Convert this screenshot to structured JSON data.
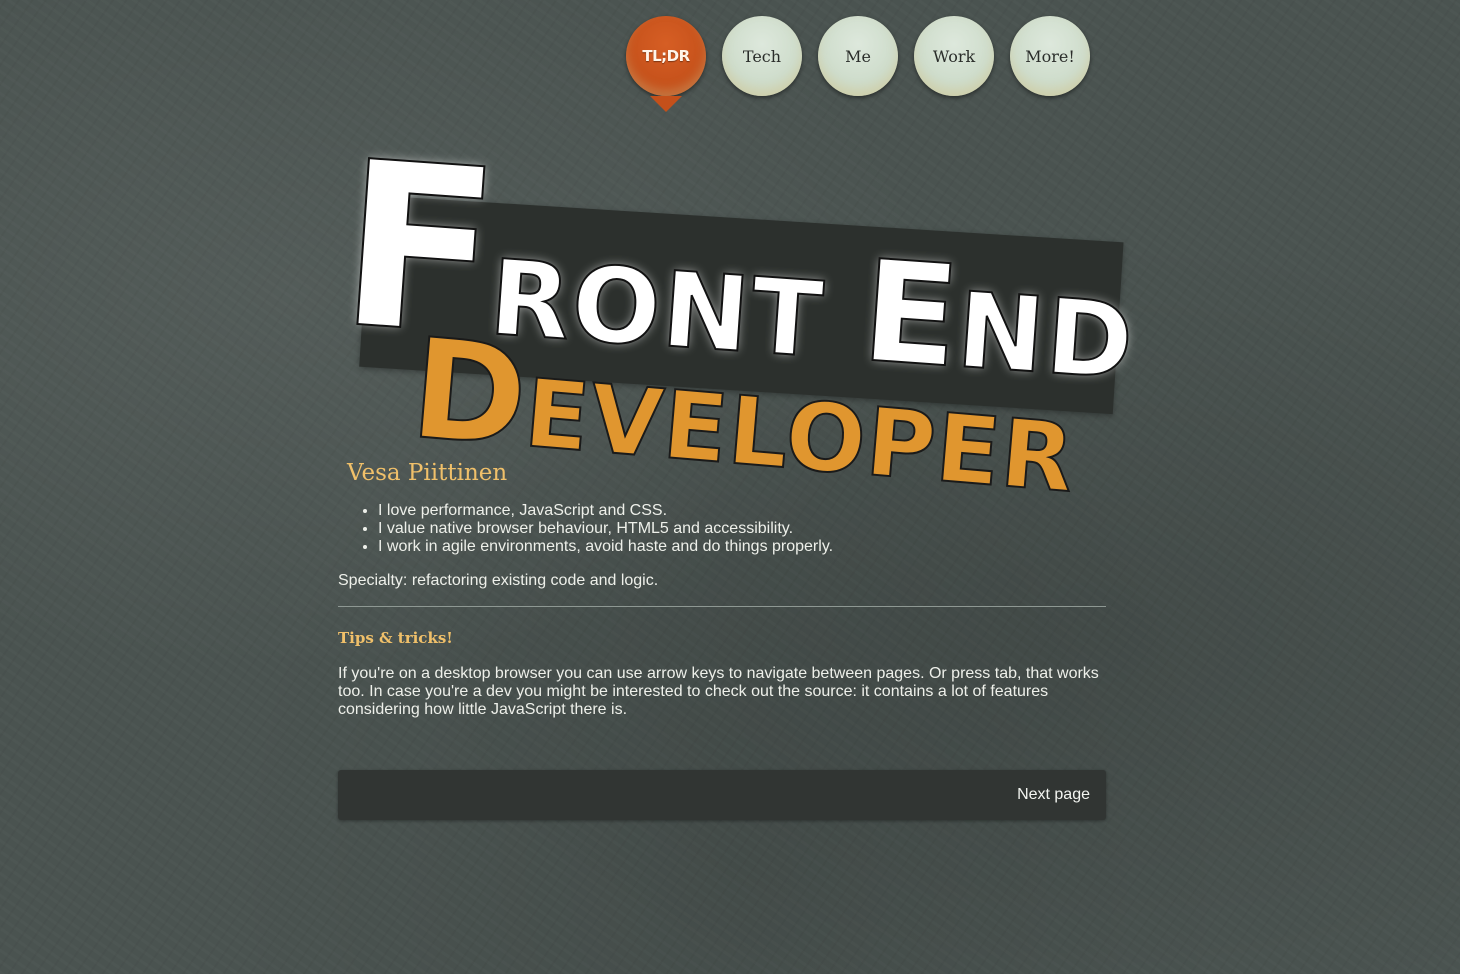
{
  "nav": {
    "items": [
      {
        "label": "TL;DR",
        "active": true
      },
      {
        "label": "Tech",
        "active": false
      },
      {
        "label": "Me",
        "active": false
      },
      {
        "label": "Work",
        "active": false
      },
      {
        "label": "More!",
        "active": false
      }
    ]
  },
  "hero": {
    "front_initial": "F",
    "front_rest": "RONT ",
    "end_initial": "E",
    "end_rest": "ND",
    "dev_initial": "D",
    "dev_rest": "EVELOPER"
  },
  "profile": {
    "name": "Vesa Piittinen",
    "points": [
      "I love performance, JavaScript and CSS.",
      "I value native browser behaviour, HTML5 and accessibility.",
      "I work in agile environments, avoid haste and do things properly."
    ],
    "specialty": "Specialty: refactoring existing code and logic."
  },
  "tips": {
    "title": "Tips & tricks!",
    "text": "If you're on a desktop browser you can use arrow keys to navigate between pages. Or press tab, that works too. In case you're a dev you might be interested to check out the source: it contains a lot of features considering how little JavaScript there is."
  },
  "pager": {
    "next_label": "Next page"
  },
  "colors": {
    "accent_orange": "#c4501a",
    "heading_gold": "#f0c06a",
    "developer_orange": "#e0962f",
    "background": "#4a5350"
  }
}
